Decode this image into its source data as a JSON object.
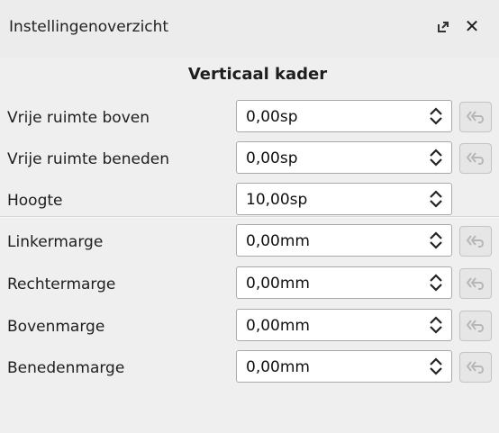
{
  "panel": {
    "title": "Instellingenoverzicht",
    "float_icon": "undock-icon",
    "close_icon": "close-icon",
    "close_glyph": "✕"
  },
  "section": {
    "title": "Verticaal kader"
  },
  "rows": [
    {
      "label": "Vrije ruimte boven",
      "value": "0,00sp",
      "reset": true
    },
    {
      "label": "Vrije ruimte beneden",
      "value": "0,00sp",
      "reset": true
    },
    {
      "label": "Hoogte",
      "value": "10,00sp",
      "reset": false
    },
    {
      "label": "Linkermarge",
      "value": "0,00mm",
      "reset": true
    },
    {
      "label": "Rechtermarge",
      "value": "0,00mm",
      "reset": true
    },
    {
      "label": "Bovenmarge",
      "value": "0,00mm",
      "reset": true
    },
    {
      "label": "Benedenmarge",
      "value": "0,00mm",
      "reset": true
    }
  ],
  "colors": {
    "background": "#efefef",
    "field_background": "#ffffff",
    "reset_icon": "#b7b7b7"
  }
}
